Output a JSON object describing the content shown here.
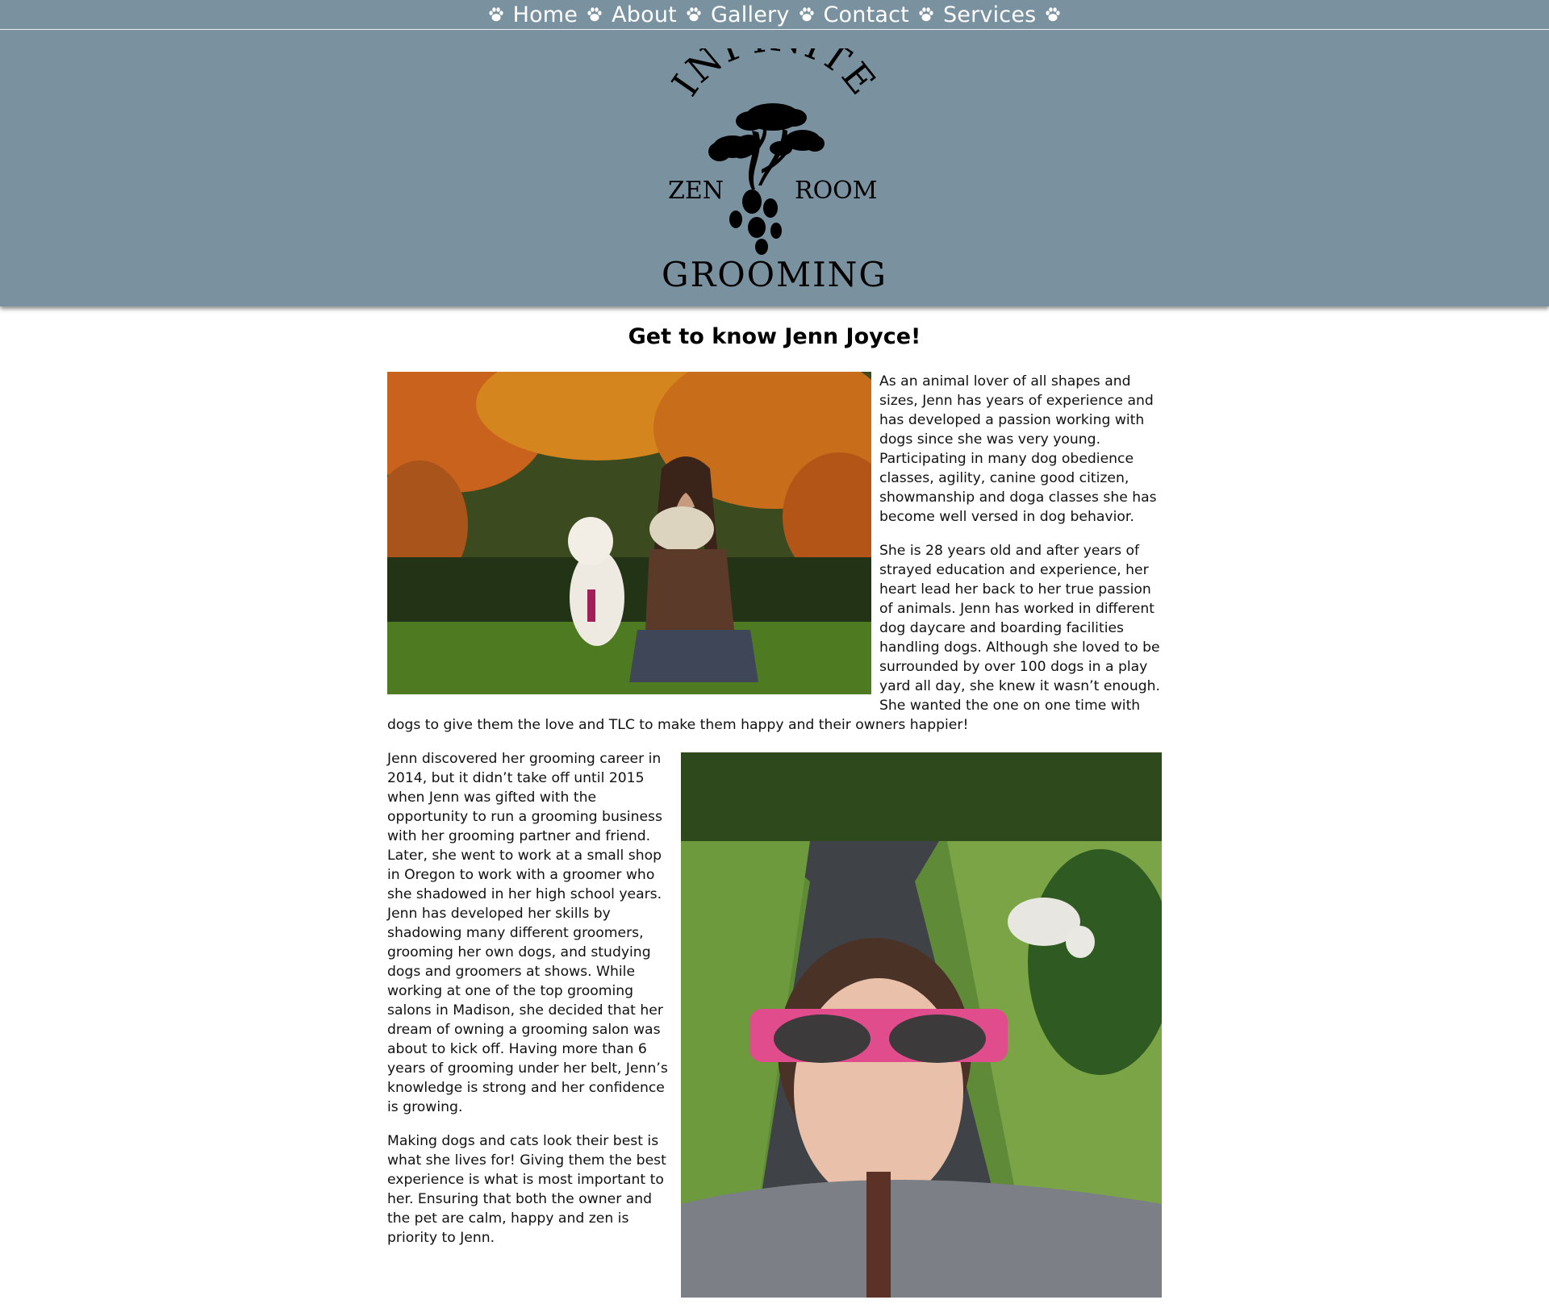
{
  "nav": {
    "items": [
      {
        "label": "Home"
      },
      {
        "label": "About"
      },
      {
        "label": "Gallery"
      },
      {
        "label": "Contact"
      },
      {
        "label": "Services"
      }
    ]
  },
  "logo": {
    "top_text": "INFINITE",
    "left_text": "ZEN",
    "right_text": "ROOM",
    "bottom_text": "GROOMING"
  },
  "page": {
    "title": "Get to know Jenn Joyce!"
  },
  "paragraphs": [
    "As an animal lover of all shapes and sizes, Jenn has years of experience and has developed a passion working with dogs since she was very young. Participating in many dog obedience classes, agility, canine good citizen, showmanship and doga classes she has become well versed in dog behavior.",
    "She is 28 years old and after years of strayed education and experience, her heart lead her back to her true passion of animals. Jenn has worked in different dog daycare and boarding facilities handling dogs. Although she loved to be surrounded by over 100 dogs in a play yard all day, she knew it wasn’t enough. She wanted the one on one time with dogs to give them the love and TLC to make them happy and their owners happier!",
    "Jenn discovered her grooming career in 2014, but it didn’t take off until 2015 when Jenn was gifted with the opportunity to run a grooming business with her grooming partner and friend. Later, she went to work at a small shop in Oregon to work with a groomer who she shadowed in her high school years. Jenn has developed her skills by shadowing many different groomers, grooming her own dogs, and studying dogs and groomers at shows. While working at one of the top grooming salons in Madison, she decided that her dream of owning a grooming salon was about to kick off. Having more than 6 years of grooming under her belt, Jenn’s knowledge is strong and her confidence is growing.",
    "Making dogs and cats look their best is what she lives for! Giving them the best experience is what is most important to her. Ensuring that both the owner and the pet are calm, happy and zen is priority to Jenn."
  ],
  "colors": {
    "header_bg": "#7a929f",
    "nav_text": "#ffffff",
    "body_text": "#111111"
  },
  "icons": [
    "paw-icon"
  ]
}
